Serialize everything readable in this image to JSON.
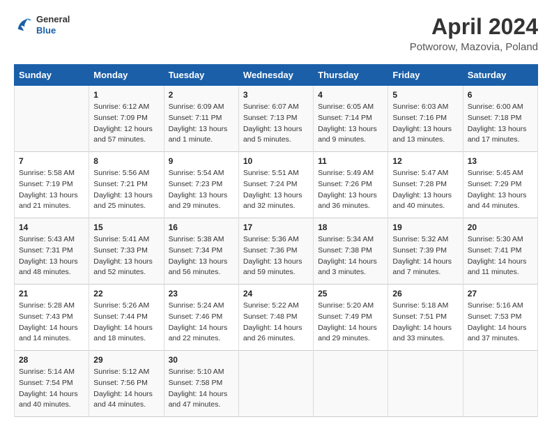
{
  "header": {
    "logo": {
      "general": "General",
      "blue": "Blue"
    },
    "title": "April 2024",
    "subtitle": "Potworow, Mazovia, Poland"
  },
  "columns": [
    "Sunday",
    "Monday",
    "Tuesday",
    "Wednesday",
    "Thursday",
    "Friday",
    "Saturday"
  ],
  "weeks": [
    [
      {
        "day": "",
        "sunrise": "",
        "sunset": "",
        "daylight": ""
      },
      {
        "day": "1",
        "sunrise": "Sunrise: 6:12 AM",
        "sunset": "Sunset: 7:09 PM",
        "daylight": "Daylight: 12 hours and 57 minutes."
      },
      {
        "day": "2",
        "sunrise": "Sunrise: 6:09 AM",
        "sunset": "Sunset: 7:11 PM",
        "daylight": "Daylight: 13 hours and 1 minute."
      },
      {
        "day": "3",
        "sunrise": "Sunrise: 6:07 AM",
        "sunset": "Sunset: 7:13 PM",
        "daylight": "Daylight: 13 hours and 5 minutes."
      },
      {
        "day": "4",
        "sunrise": "Sunrise: 6:05 AM",
        "sunset": "Sunset: 7:14 PM",
        "daylight": "Daylight: 13 hours and 9 minutes."
      },
      {
        "day": "5",
        "sunrise": "Sunrise: 6:03 AM",
        "sunset": "Sunset: 7:16 PM",
        "daylight": "Daylight: 13 hours and 13 minutes."
      },
      {
        "day": "6",
        "sunrise": "Sunrise: 6:00 AM",
        "sunset": "Sunset: 7:18 PM",
        "daylight": "Daylight: 13 hours and 17 minutes."
      }
    ],
    [
      {
        "day": "7",
        "sunrise": "Sunrise: 5:58 AM",
        "sunset": "Sunset: 7:19 PM",
        "daylight": "Daylight: 13 hours and 21 minutes."
      },
      {
        "day": "8",
        "sunrise": "Sunrise: 5:56 AM",
        "sunset": "Sunset: 7:21 PM",
        "daylight": "Daylight: 13 hours and 25 minutes."
      },
      {
        "day": "9",
        "sunrise": "Sunrise: 5:54 AM",
        "sunset": "Sunset: 7:23 PM",
        "daylight": "Daylight: 13 hours and 29 minutes."
      },
      {
        "day": "10",
        "sunrise": "Sunrise: 5:51 AM",
        "sunset": "Sunset: 7:24 PM",
        "daylight": "Daylight: 13 hours and 32 minutes."
      },
      {
        "day": "11",
        "sunrise": "Sunrise: 5:49 AM",
        "sunset": "Sunset: 7:26 PM",
        "daylight": "Daylight: 13 hours and 36 minutes."
      },
      {
        "day": "12",
        "sunrise": "Sunrise: 5:47 AM",
        "sunset": "Sunset: 7:28 PM",
        "daylight": "Daylight: 13 hours and 40 minutes."
      },
      {
        "day": "13",
        "sunrise": "Sunrise: 5:45 AM",
        "sunset": "Sunset: 7:29 PM",
        "daylight": "Daylight: 13 hours and 44 minutes."
      }
    ],
    [
      {
        "day": "14",
        "sunrise": "Sunrise: 5:43 AM",
        "sunset": "Sunset: 7:31 PM",
        "daylight": "Daylight: 13 hours and 48 minutes."
      },
      {
        "day": "15",
        "sunrise": "Sunrise: 5:41 AM",
        "sunset": "Sunset: 7:33 PM",
        "daylight": "Daylight: 13 hours and 52 minutes."
      },
      {
        "day": "16",
        "sunrise": "Sunrise: 5:38 AM",
        "sunset": "Sunset: 7:34 PM",
        "daylight": "Daylight: 13 hours and 56 minutes."
      },
      {
        "day": "17",
        "sunrise": "Sunrise: 5:36 AM",
        "sunset": "Sunset: 7:36 PM",
        "daylight": "Daylight: 13 hours and 59 minutes."
      },
      {
        "day": "18",
        "sunrise": "Sunrise: 5:34 AM",
        "sunset": "Sunset: 7:38 PM",
        "daylight": "Daylight: 14 hours and 3 minutes."
      },
      {
        "day": "19",
        "sunrise": "Sunrise: 5:32 AM",
        "sunset": "Sunset: 7:39 PM",
        "daylight": "Daylight: 14 hours and 7 minutes."
      },
      {
        "day": "20",
        "sunrise": "Sunrise: 5:30 AM",
        "sunset": "Sunset: 7:41 PM",
        "daylight": "Daylight: 14 hours and 11 minutes."
      }
    ],
    [
      {
        "day": "21",
        "sunrise": "Sunrise: 5:28 AM",
        "sunset": "Sunset: 7:43 PM",
        "daylight": "Daylight: 14 hours and 14 minutes."
      },
      {
        "day": "22",
        "sunrise": "Sunrise: 5:26 AM",
        "sunset": "Sunset: 7:44 PM",
        "daylight": "Daylight: 14 hours and 18 minutes."
      },
      {
        "day": "23",
        "sunrise": "Sunrise: 5:24 AM",
        "sunset": "Sunset: 7:46 PM",
        "daylight": "Daylight: 14 hours and 22 minutes."
      },
      {
        "day": "24",
        "sunrise": "Sunrise: 5:22 AM",
        "sunset": "Sunset: 7:48 PM",
        "daylight": "Daylight: 14 hours and 26 minutes."
      },
      {
        "day": "25",
        "sunrise": "Sunrise: 5:20 AM",
        "sunset": "Sunset: 7:49 PM",
        "daylight": "Daylight: 14 hours and 29 minutes."
      },
      {
        "day": "26",
        "sunrise": "Sunrise: 5:18 AM",
        "sunset": "Sunset: 7:51 PM",
        "daylight": "Daylight: 14 hours and 33 minutes."
      },
      {
        "day": "27",
        "sunrise": "Sunrise: 5:16 AM",
        "sunset": "Sunset: 7:53 PM",
        "daylight": "Daylight: 14 hours and 37 minutes."
      }
    ],
    [
      {
        "day": "28",
        "sunrise": "Sunrise: 5:14 AM",
        "sunset": "Sunset: 7:54 PM",
        "daylight": "Daylight: 14 hours and 40 minutes."
      },
      {
        "day": "29",
        "sunrise": "Sunrise: 5:12 AM",
        "sunset": "Sunset: 7:56 PM",
        "daylight": "Daylight: 14 hours and 44 minutes."
      },
      {
        "day": "30",
        "sunrise": "Sunrise: 5:10 AM",
        "sunset": "Sunset: 7:58 PM",
        "daylight": "Daylight: 14 hours and 47 minutes."
      },
      {
        "day": "",
        "sunrise": "",
        "sunset": "",
        "daylight": ""
      },
      {
        "day": "",
        "sunrise": "",
        "sunset": "",
        "daylight": ""
      },
      {
        "day": "",
        "sunrise": "",
        "sunset": "",
        "daylight": ""
      },
      {
        "day": "",
        "sunrise": "",
        "sunset": "",
        "daylight": ""
      }
    ]
  ]
}
